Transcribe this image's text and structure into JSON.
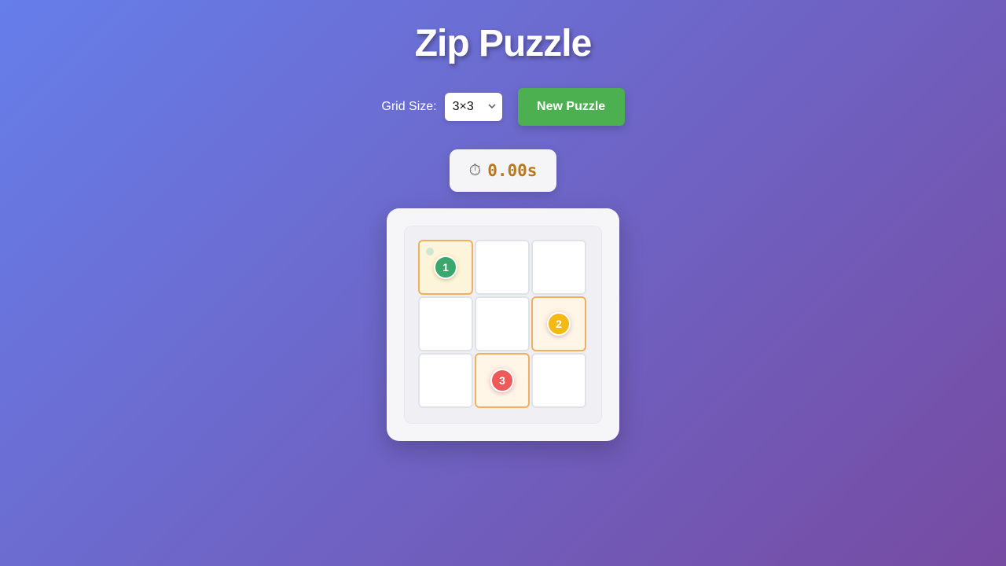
{
  "title": "Zip Puzzle",
  "controls": {
    "grid_size_label": "Grid Size:",
    "grid_size_value": "3×3",
    "new_puzzle_label": "New Puzzle"
  },
  "timer": {
    "icon": "stopwatch-icon",
    "value": "0.00s"
  },
  "grid": {
    "rows": 3,
    "cols": 3,
    "cells": [
      {
        "number": "1",
        "color": "#3aa76d",
        "glow": "rgba(255,225,120,0.6)",
        "start": true
      },
      {
        "number": ""
      },
      {
        "number": ""
      },
      {
        "number": ""
      },
      {
        "number": ""
      },
      {
        "number": "2",
        "color": "#f5b915",
        "glow": "rgba(255,120,140,0.35)"
      },
      {
        "number": ""
      },
      {
        "number": "3",
        "color": "#ee5a5a",
        "glow": "rgba(255,120,140,0.4)"
      },
      {
        "number": ""
      }
    ]
  },
  "colors": {
    "accent_button": "#4caf50",
    "timer_text": "#b7791f",
    "numbered_cell_border": "#f0b060"
  }
}
